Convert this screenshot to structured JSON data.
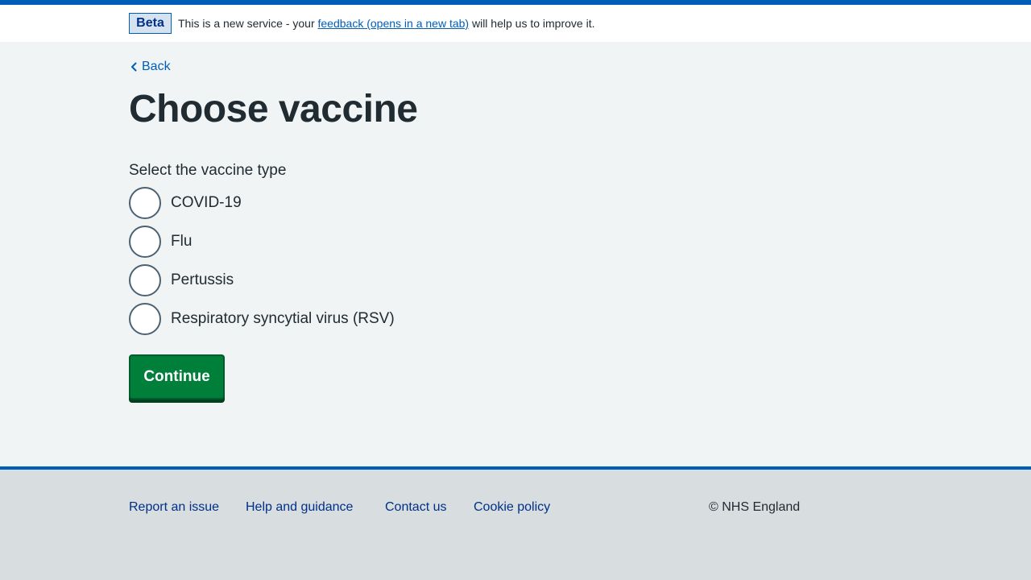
{
  "colors": {
    "brand_blue": "#005eb8",
    "dark_blue": "#003087",
    "button_green": "#007f3b",
    "background": "#f0f4f5",
    "footer_bg": "#d8dde0"
  },
  "phase_banner": {
    "tag": "Beta",
    "text_before": "This is a new service - your ",
    "link_text": "feedback (opens in a new tab)",
    "text_after": " will help us to improve it."
  },
  "back_link": {
    "label": "Back",
    "icon": "chevron-left-icon"
  },
  "page_title": "Choose vaccine",
  "form": {
    "legend": "Select the vaccine type",
    "options": [
      {
        "label": "COVID-19",
        "checked": false
      },
      {
        "label": "Flu",
        "checked": false
      },
      {
        "label": "Pertussis",
        "checked": false
      },
      {
        "label": "Respiratory syncytial virus (RSV)",
        "checked": false
      }
    ],
    "continue_label": "Continue"
  },
  "footer": {
    "links": [
      "Report an issue",
      "Help and guidance",
      "Contact us",
      "Cookie policy"
    ],
    "copyright": "© NHS England"
  }
}
